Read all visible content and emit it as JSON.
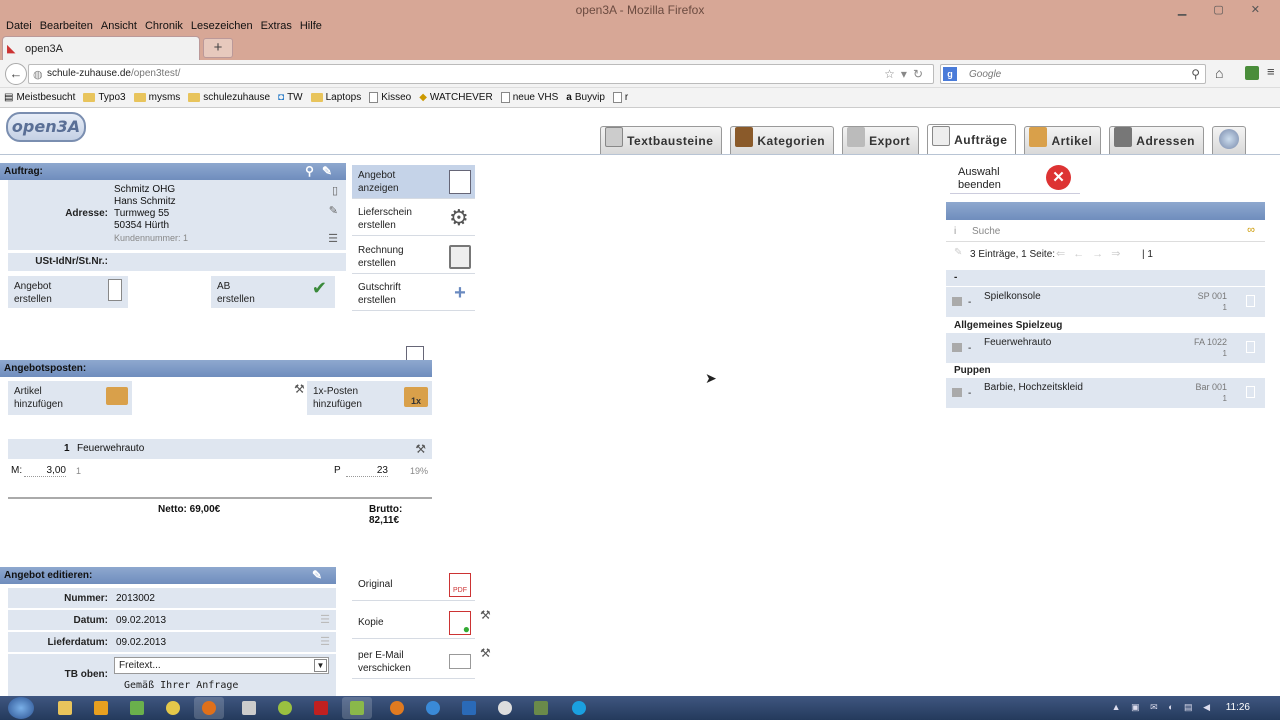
{
  "browser": {
    "title": "open3A - Mozilla Firefox",
    "menu": [
      "Datei",
      "Bearbeiten",
      "Ansicht",
      "Chronik",
      "Lesezeichen",
      "Extras",
      "Hilfe"
    ],
    "tab_label": "open3A",
    "newtab": "+",
    "url_host": "schule-zuhause.de",
    "url_path": "/open3test/",
    "search_placeholder": "Google",
    "back": "←",
    "bookmarks": [
      "Meistbesucht",
      "Typo3",
      "mysms",
      "schulezuhause",
      "TW",
      "Laptops",
      "Kisseo",
      "WATCHEVER",
      "neue VHS",
      "Buyvip",
      "r"
    ]
  },
  "app": {
    "logo": "open3A",
    "nav": [
      "Textbausteine",
      "Kategorien",
      "Export",
      "Aufträge",
      "Artikel",
      "Adressen"
    ],
    "active_nav": "Aufträge"
  },
  "auftrag": {
    "header": "Auftrag:",
    "adresse_label": "Adresse:",
    "address_lines": [
      "Schmitz OHG",
      "Hans Schmitz",
      "Turmweg 55",
      "50354 Hürth"
    ],
    "kundennummer": "Kundennummer: 1",
    "ust_label": "USt-IdNr/St.Nr.:",
    "angebot_btn": [
      "Angebot",
      "erstellen"
    ],
    "ab_btn": [
      "AB",
      "erstellen"
    ]
  },
  "side_actions": [
    [
      "Angebot",
      "anzeigen"
    ],
    [
      "Lieferschein",
      "erstellen"
    ],
    [
      "Rechnung",
      "erstellen"
    ],
    [
      "Gutschrift",
      "erstellen"
    ]
  ],
  "posten": {
    "header": "Angebotsposten:",
    "artikel_btn": [
      "Artikel",
      "hinzufügen"
    ],
    "einmal_btn": [
      "1x-Posten",
      "hinzufügen"
    ],
    "item_qty": "1",
    "item_name": "Feuerwehrauto",
    "m_label": "M:",
    "m_value": "3,00",
    "m_unit": "1",
    "p_label": "P",
    "p_value": "23",
    "vat": "19%",
    "netto": "Netto: 69,00€",
    "brutto": "Brutto: 82,11€"
  },
  "edit": {
    "header": "Angebot editieren:",
    "fields": [
      {
        "label": "Nummer:",
        "value": "2013002"
      },
      {
        "label": "Datum:",
        "value": "09.02.2013"
      },
      {
        "label": "Lieferdatum:",
        "value": "09.02.2013"
      }
    ],
    "tb_oben_label": "TB oben:",
    "tb_select": "Freitext...",
    "tb_text": "Gemäß Ihrer Anfrage"
  },
  "doc_actions": [
    [
      "Original"
    ],
    [
      "Kopie"
    ],
    [
      "per E-Mail",
      "verschicken"
    ]
  ],
  "right": {
    "auswahl": [
      "Auswahl",
      "beenden"
    ],
    "search_placeholder": "Suche",
    "paging": "3 Einträge, 1 Seite:",
    "page_num": "| 1",
    "group0": "-",
    "items": [
      {
        "group": "",
        "name": "Spielkonsole",
        "code": "SP 001",
        "qty": "1"
      },
      {
        "group": "Allgemeines Spielzeug",
        "name": "Feuerwehrauto",
        "code": "FA 1022",
        "qty": "1"
      },
      {
        "group": "Puppen",
        "name": "Barbie, Hochzeitskleid",
        "code": "Bar 001",
        "qty": "1"
      }
    ]
  },
  "taskbar": {
    "clock": "11:26"
  }
}
